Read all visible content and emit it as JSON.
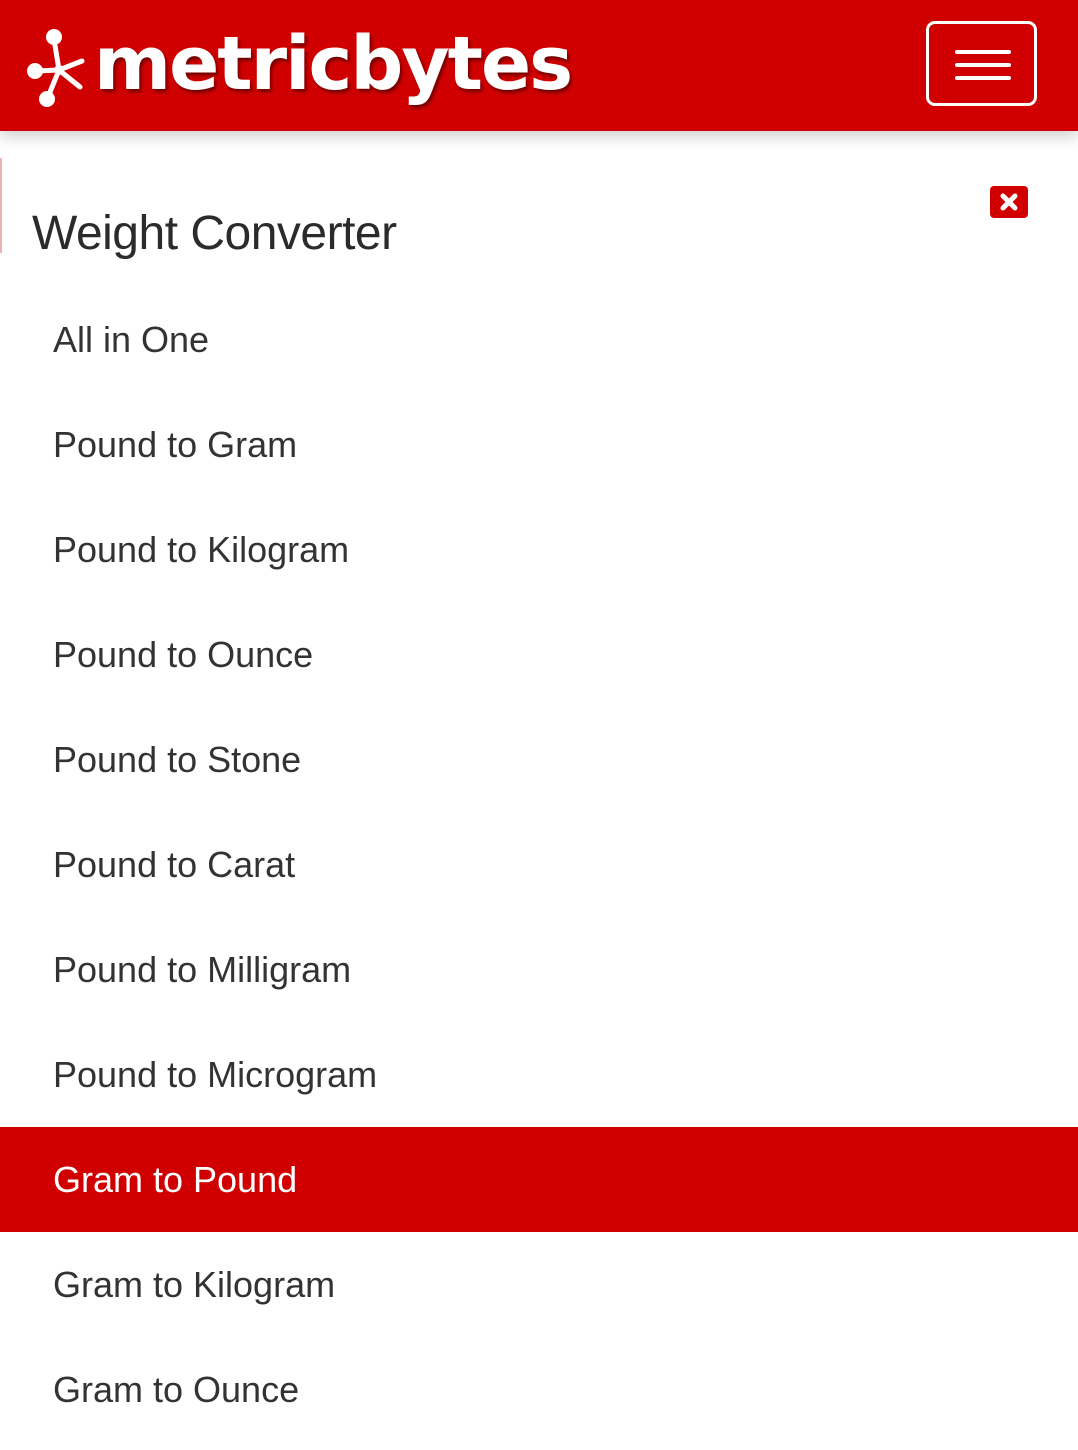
{
  "header": {
    "brand": "metricbytes",
    "logo_icon": "molecule-icon",
    "menu_icon": "hamburger-icon",
    "bg_color": "#d10000"
  },
  "panel": {
    "title": "Weight Converter",
    "close_icon": "close-icon",
    "items": [
      {
        "label": "All in One",
        "active": false
      },
      {
        "label": "Pound to Gram",
        "active": false
      },
      {
        "label": "Pound to Kilogram",
        "active": false
      },
      {
        "label": "Pound to Ounce",
        "active": false
      },
      {
        "label": "Pound to Stone",
        "active": false
      },
      {
        "label": "Pound to Carat",
        "active": false
      },
      {
        "label": "Pound to Milligram",
        "active": false
      },
      {
        "label": "Pound to Microgram",
        "active": false
      },
      {
        "label": "Gram to Pound",
        "active": true
      },
      {
        "label": "Gram to Kilogram",
        "active": false
      },
      {
        "label": "Gram to Ounce",
        "active": false
      }
    ]
  },
  "colors": {
    "accent": "#d10000",
    "text": "#333333",
    "active_text": "#ffffff"
  }
}
